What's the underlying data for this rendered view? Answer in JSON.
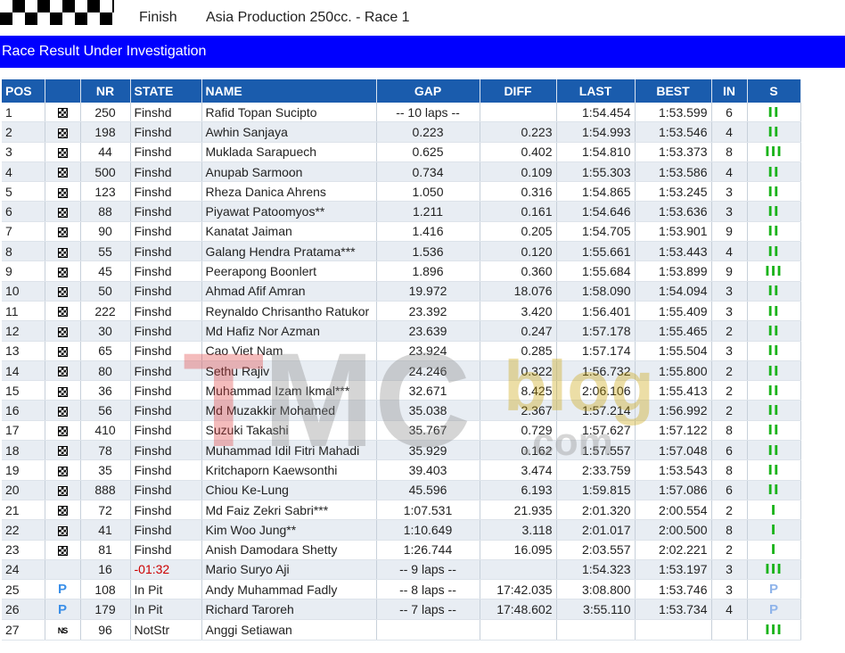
{
  "header": {
    "state": "Finish",
    "race_title": "Asia Production 250cc. - Race 1"
  },
  "banner": "Race Result Under Investigation",
  "watermark_text": "TMCblog.com",
  "columns": [
    "POS",
    "",
    "NR",
    "STATE",
    "NAME",
    "GAP",
    "DIFF",
    "LAST",
    "BEST",
    "IN",
    "S"
  ],
  "rows": [
    {
      "pos": "1",
      "icon": "finish",
      "nr": "250",
      "state": "Finshd",
      "name": "Rafid Topan Sucipto",
      "gap": "-- 10 laps --",
      "diff": "",
      "last": "1:54.454",
      "best": "1:53.599",
      "in": "6",
      "s": "II"
    },
    {
      "pos": "2",
      "icon": "finish",
      "nr": "198",
      "state": "Finshd",
      "name": "Awhin Sanjaya",
      "gap": "0.223",
      "diff": "0.223",
      "last": "1:54.993",
      "best": "1:53.546",
      "in": "4",
      "s": "II"
    },
    {
      "pos": "3",
      "icon": "finish",
      "nr": "44",
      "state": "Finshd",
      "name": "Muklada Sarapuech",
      "gap": "0.625",
      "diff": "0.402",
      "last": "1:54.810",
      "best": "1:53.373",
      "in": "8",
      "s": "III"
    },
    {
      "pos": "4",
      "icon": "finish",
      "nr": "500",
      "state": "Finshd",
      "name": "Anupab Sarmoon",
      "gap": "0.734",
      "diff": "0.109",
      "last": "1:55.303",
      "best": "1:53.586",
      "in": "4",
      "s": "II"
    },
    {
      "pos": "5",
      "icon": "finish",
      "nr": "123",
      "state": "Finshd",
      "name": "Rheza Danica Ahrens",
      "gap": "1.050",
      "diff": "0.316",
      "last": "1:54.865",
      "best": "1:53.245",
      "in": "3",
      "s": "II"
    },
    {
      "pos": "6",
      "icon": "finish",
      "nr": "88",
      "state": "Finshd",
      "name": "Piyawat Patoomyos**",
      "gap": "1.211",
      "diff": "0.161",
      "last": "1:54.646",
      "best": "1:53.636",
      "in": "3",
      "s": "II"
    },
    {
      "pos": "7",
      "icon": "finish",
      "nr": "90",
      "state": "Finshd",
      "name": "Kanatat Jaiman",
      "gap": "1.416",
      "diff": "0.205",
      "last": "1:54.705",
      "best": "1:53.901",
      "in": "9",
      "s": "II"
    },
    {
      "pos": "8",
      "icon": "finish",
      "nr": "55",
      "state": "Finshd",
      "name": "Galang Hendra Pratama***",
      "gap": "1.536",
      "diff": "0.120",
      "last": "1:55.661",
      "best": "1:53.443",
      "in": "4",
      "s": "II"
    },
    {
      "pos": "9",
      "icon": "finish",
      "nr": "45",
      "state": "Finshd",
      "name": "Peerapong Boonlert",
      "gap": "1.896",
      "diff": "0.360",
      "last": "1:55.684",
      "best": "1:53.899",
      "in": "9",
      "s": "III"
    },
    {
      "pos": "10",
      "icon": "finish",
      "nr": "50",
      "state": "Finshd",
      "name": "Ahmad Afif Amran",
      "gap": "19.972",
      "diff": "18.076",
      "last": "1:58.090",
      "best": "1:54.094",
      "in": "3",
      "s": "II"
    },
    {
      "pos": "11",
      "icon": "finish",
      "nr": "222",
      "state": "Finshd",
      "name": "Reynaldo Chrisantho Ratukor",
      "gap": "23.392",
      "diff": "3.420",
      "last": "1:56.401",
      "best": "1:55.409",
      "in": "3",
      "s": "II"
    },
    {
      "pos": "12",
      "icon": "finish",
      "nr": "30",
      "state": "Finshd",
      "name": "Md Hafiz Nor Azman",
      "gap": "23.639",
      "diff": "0.247",
      "last": "1:57.178",
      "best": "1:55.465",
      "in": "2",
      "s": "II"
    },
    {
      "pos": "13",
      "icon": "finish",
      "nr": "65",
      "state": "Finshd",
      "name": "Cao Viet Nam",
      "gap": "23.924",
      "diff": "0.285",
      "last": "1:57.174",
      "best": "1:55.504",
      "in": "3",
      "s": "II"
    },
    {
      "pos": "14",
      "icon": "finish",
      "nr": "80",
      "state": "Finshd",
      "name": "Sethu Rajiv",
      "gap": "24.246",
      "diff": "0.322",
      "last": "1:56.732",
      "best": "1:55.800",
      "in": "2",
      "s": "II"
    },
    {
      "pos": "15",
      "icon": "finish",
      "nr": "36",
      "state": "Finshd",
      "name": "Muhammad Izam Ikmal***",
      "gap": "32.671",
      "diff": "8.425",
      "last": "2:06.106",
      "best": "1:55.413",
      "in": "2",
      "s": "II"
    },
    {
      "pos": "16",
      "icon": "finish",
      "nr": "56",
      "state": "Finshd",
      "name": "Md Muzakkir Mohamed",
      "gap": "35.038",
      "diff": "2.367",
      "last": "1:57.214",
      "best": "1:56.992",
      "in": "2",
      "s": "II"
    },
    {
      "pos": "17",
      "icon": "finish",
      "nr": "410",
      "state": "Finshd",
      "name": "Suzuki Takashi",
      "gap": "35.767",
      "diff": "0.729",
      "last": "1:57.627",
      "best": "1:57.122",
      "in": "8",
      "s": "II"
    },
    {
      "pos": "18",
      "icon": "finish",
      "nr": "78",
      "state": "Finshd",
      "name": "Muhammad Idil Fitri Mahadi",
      "gap": "35.929",
      "diff": "0.162",
      "last": "1:57.557",
      "best": "1:57.048",
      "in": "6",
      "s": "II"
    },
    {
      "pos": "19",
      "icon": "finish",
      "nr": "35",
      "state": "Finshd",
      "name": "Kritchaporn Kaewsonthi",
      "gap": "39.403",
      "diff": "3.474",
      "last": "2:33.759",
      "best": "1:53.543",
      "in": "8",
      "s": "II"
    },
    {
      "pos": "20",
      "icon": "finish",
      "nr": "888",
      "state": "Finshd",
      "name": "Chiou Ke-Lung",
      "gap": "45.596",
      "diff": "6.193",
      "last": "1:59.815",
      "best": "1:57.086",
      "in": "6",
      "s": "II"
    },
    {
      "pos": "21",
      "icon": "finish",
      "nr": "72",
      "state": "Finshd",
      "name": "Md Faiz Zekri Sabri***",
      "gap": "1:07.531",
      "diff": "21.935",
      "last": "2:01.320",
      "best": "2:00.554",
      "in": "2",
      "s": "I"
    },
    {
      "pos": "22",
      "icon": "finish",
      "nr": "41",
      "state": "Finshd",
      "name": "Kim Woo Jung**",
      "gap": "1:10.649",
      "diff": "3.118",
      "last": "2:01.017",
      "best": "2:00.500",
      "in": "8",
      "s": "I"
    },
    {
      "pos": "23",
      "icon": "finish",
      "nr": "81",
      "state": "Finshd",
      "name": "Anish Damodara Shetty",
      "gap": "1:26.744",
      "diff": "16.095",
      "last": "2:03.557",
      "best": "2:02.221",
      "in": "2",
      "s": "I"
    },
    {
      "pos": "24",
      "icon": "",
      "nr": "16",
      "state": "-01:32",
      "name": "Mario Suryo Aji",
      "gap": "-- 9 laps --",
      "diff": "",
      "last": "1:54.323",
      "best": "1:53.197",
      "in": "3",
      "s": "III"
    },
    {
      "pos": "25",
      "icon": "P",
      "nr": "108",
      "state": "In Pit",
      "name": "Andy Muhammad Fadly",
      "gap": "-- 8 laps --",
      "diff": "17:42.035",
      "last": "3:08.800",
      "best": "1:53.746",
      "in": "3",
      "s": "P"
    },
    {
      "pos": "26",
      "icon": "P",
      "nr": "179",
      "state": "In Pit",
      "name": "Richard Taroreh",
      "gap": "-- 7 laps --",
      "diff": "17:48.602",
      "last": "3:55.110",
      "best": "1:53.734",
      "in": "4",
      "s": "P"
    },
    {
      "pos": "27",
      "icon": "NS",
      "nr": "96",
      "state": "NotStr",
      "name": "Anggi Setiawan",
      "gap": "",
      "diff": "",
      "last": "",
      "best": "",
      "in": "",
      "s": "III"
    }
  ]
}
